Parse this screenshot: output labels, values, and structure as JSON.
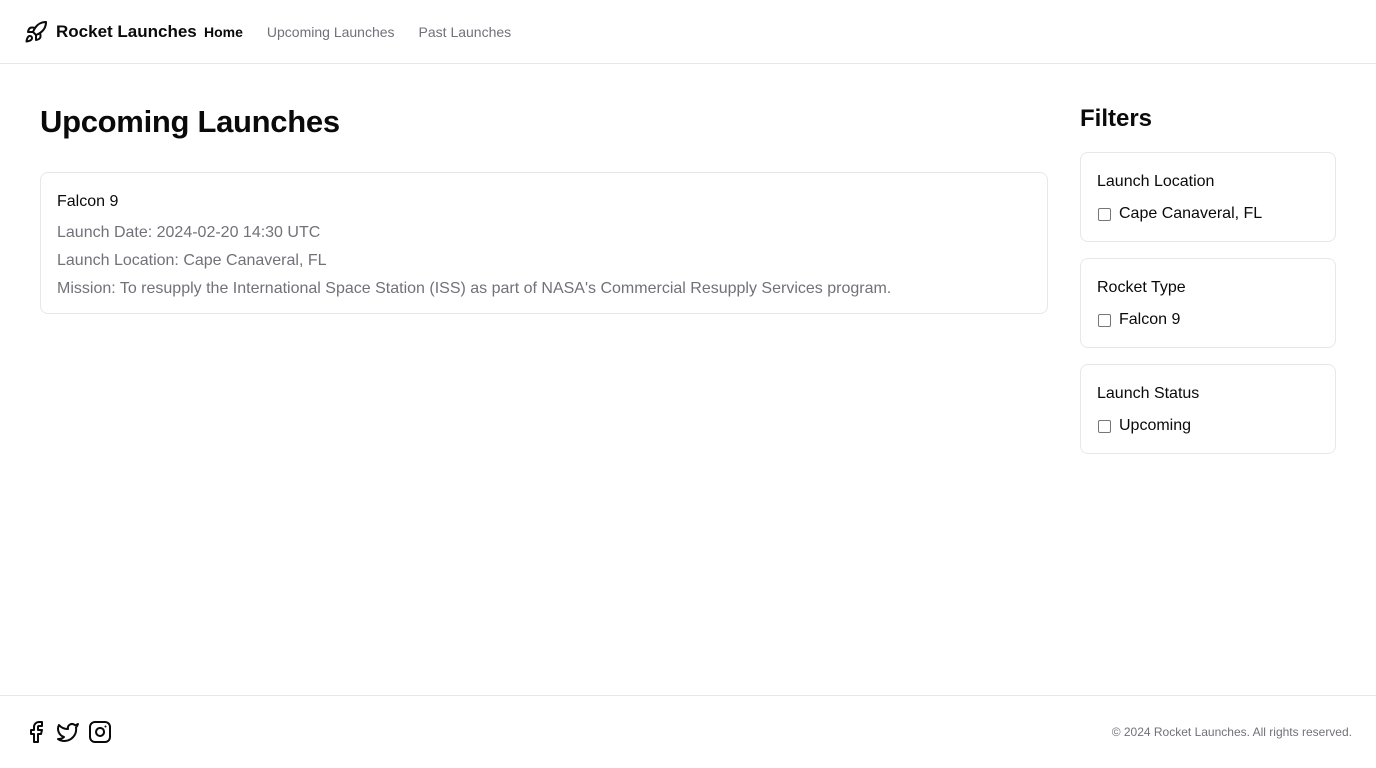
{
  "header": {
    "brand_icon": "rocket-icon",
    "brand_name": "Rocket Launches",
    "nav": [
      {
        "label": "Home",
        "active": true
      },
      {
        "label": "Upcoming Launches",
        "active": false
      },
      {
        "label": "Past Launches",
        "active": false
      }
    ]
  },
  "main": {
    "title": "Upcoming Launches",
    "launches": [
      {
        "name": "Falcon 9",
        "date_line": "Launch Date: 2024-02-20 14:30 UTC",
        "location_line": "Launch Location: Cape Canaveral, FL",
        "mission_line": "Mission: To resupply the International Space Station (ISS) as part of NASA's Commercial Resupply Services program."
      }
    ]
  },
  "filters": {
    "title": "Filters",
    "groups": [
      {
        "title": "Launch Location",
        "options": [
          {
            "label": "Cape Canaveral, FL",
            "checked": false
          }
        ]
      },
      {
        "title": "Rocket Type",
        "options": [
          {
            "label": "Falcon 9",
            "checked": false
          }
        ]
      },
      {
        "title": "Launch Status",
        "options": [
          {
            "label": "Upcoming",
            "checked": false
          }
        ]
      }
    ]
  },
  "footer": {
    "social_icons": [
      "facebook-icon",
      "twitter-icon",
      "instagram-icon"
    ],
    "copyright": "© 2024 Rocket Launches. All rights reserved."
  },
  "colors": {
    "text": "#0a0a0a",
    "muted": "#71717a",
    "border": "#e5e7eb",
    "background": "#ffffff"
  }
}
